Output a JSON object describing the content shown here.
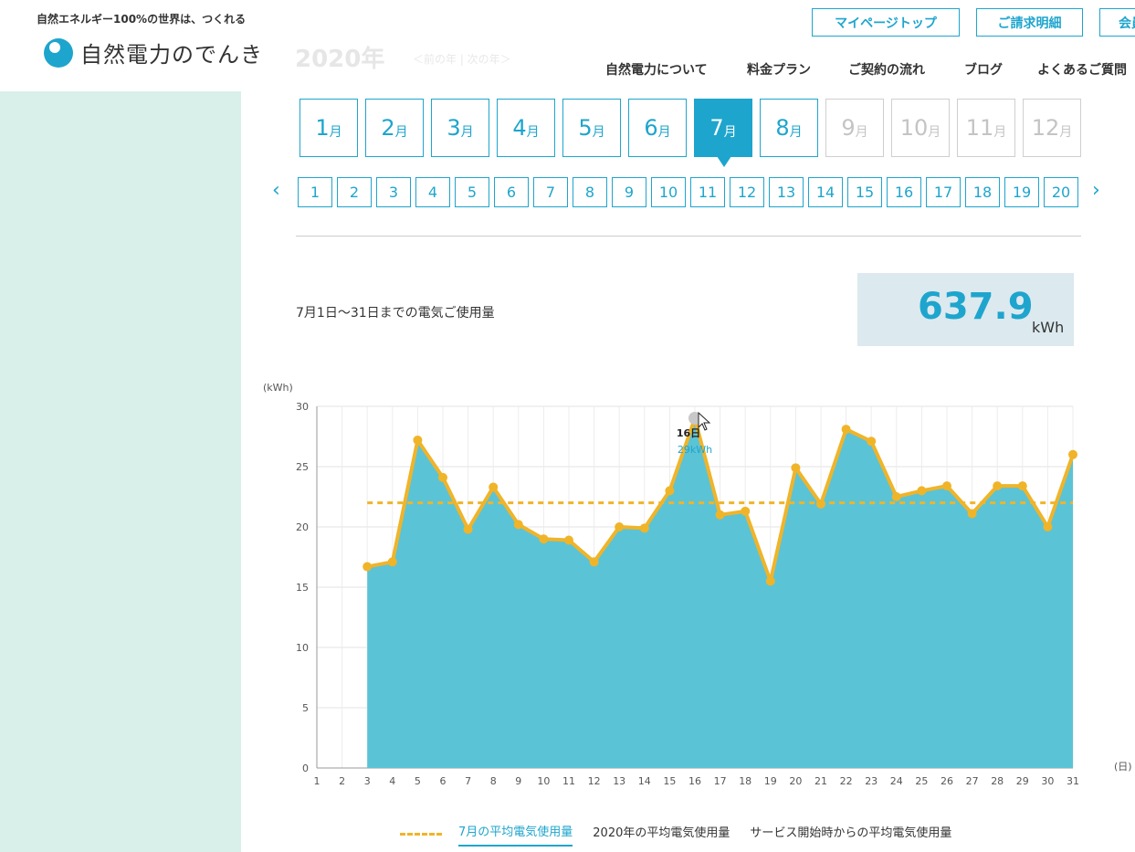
{
  "header": {
    "tagline": "自然エネルギー100%の世界は、つくれる",
    "logo_text": "自然電力のでんき",
    "faint_year": "2020年",
    "faint_links": "＜前の年 | 次の年＞",
    "buttons": [
      "マイページトップ",
      "ご請求明細",
      "会員"
    ],
    "nav": [
      "自然電力について",
      "料金プラン",
      "ご契約の流れ",
      "ブログ",
      "よくあるご質問"
    ]
  },
  "months": [
    {
      "num": "1",
      "unit": "月",
      "state": "normal"
    },
    {
      "num": "2",
      "unit": "月",
      "state": "normal"
    },
    {
      "num": "3",
      "unit": "月",
      "state": "normal"
    },
    {
      "num": "4",
      "unit": "月",
      "state": "normal"
    },
    {
      "num": "5",
      "unit": "月",
      "state": "normal"
    },
    {
      "num": "6",
      "unit": "月",
      "state": "normal"
    },
    {
      "num": "7",
      "unit": "月",
      "state": "active"
    },
    {
      "num": "8",
      "unit": "月",
      "state": "normal"
    },
    {
      "num": "9",
      "unit": "月",
      "state": "disabled"
    },
    {
      "num": "10",
      "unit": "月",
      "state": "disabled"
    },
    {
      "num": "11",
      "unit": "月",
      "state": "disabled"
    },
    {
      "num": "12",
      "unit": "月",
      "state": "disabled"
    }
  ],
  "days": [
    "1",
    "2",
    "3",
    "4",
    "5",
    "6",
    "7",
    "8",
    "9",
    "10",
    "11",
    "12",
    "13",
    "14",
    "15",
    "16",
    "17",
    "18",
    "19",
    "20"
  ],
  "pager": {
    "prev": "‹",
    "next": "›"
  },
  "summary": {
    "label": "7月1日～31日までの電気ご使用量",
    "total": "637.9",
    "unit": "kWh"
  },
  "legend": [
    "7月の平均電気使用量",
    "2020年の平均電気使用量",
    "サービス開始時からの平均電気使用量"
  ],
  "tooltip": {
    "day": "16日",
    "value": "29kWh"
  },
  "colors": {
    "accent": "#1ea5cd",
    "area": "#5bc3d6",
    "line": "#f0b429"
  },
  "chart_data": {
    "type": "area",
    "ylabel": "(kWh)",
    "xlabel": "(日)",
    "ylim": [
      0,
      30
    ],
    "yticks": [
      0,
      5,
      10,
      15,
      20,
      25,
      30
    ],
    "x": [
      1,
      2,
      3,
      4,
      5,
      6,
      7,
      8,
      9,
      10,
      11,
      12,
      13,
      14,
      15,
      16,
      17,
      18,
      19,
      20,
      21,
      22,
      23,
      24,
      25,
      26,
      27,
      28,
      29,
      30,
      31
    ],
    "series": [
      {
        "values": [
          null,
          null,
          16.7,
          17.1,
          27.2,
          24.1,
          19.8,
          23.3,
          20.2,
          19.0,
          18.9,
          17.1,
          20.0,
          19.9,
          23.0,
          29.0,
          21.0,
          21.3,
          15.5,
          24.9,
          21.9,
          28.1,
          27.1,
          22.5,
          23.0,
          23.4,
          21.1,
          23.4,
          23.4,
          20.0,
          26.0
        ]
      },
      {
        "name": "7月の平均電気使用量",
        "values": [
          22.0
        ],
        "style": "dashed-average",
        "from": 3,
        "to": 31
      }
    ],
    "grid": true
  }
}
